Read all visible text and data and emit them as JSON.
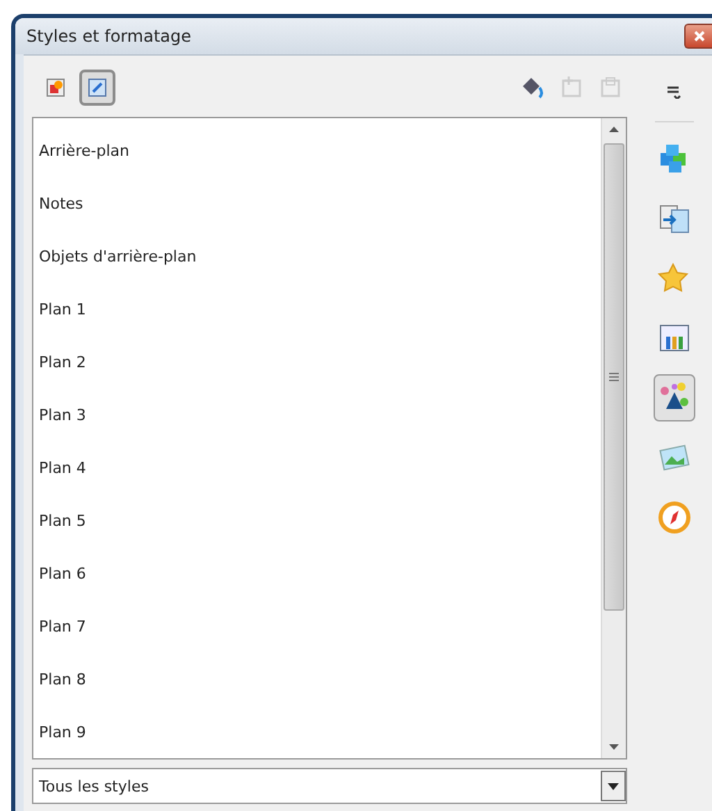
{
  "window": {
    "title": "Styles et formatage"
  },
  "style_families": [
    {
      "kind": "graphics",
      "selected": false
    },
    {
      "kind": "presentation",
      "selected": true
    }
  ],
  "styles": [
    "Arrière-plan",
    "Notes",
    "Objets d'arrière-plan",
    "Plan 1",
    "Plan 2",
    "Plan 3",
    "Plan 4",
    "Plan 5",
    "Plan 6",
    "Plan 7",
    "Plan 8",
    "Plan 9"
  ],
  "filter": {
    "value": "Tous les styles"
  },
  "deck": [
    {
      "kind": "properties",
      "selected": false
    },
    {
      "kind": "transition",
      "selected": false
    },
    {
      "kind": "animation",
      "selected": false
    },
    {
      "kind": "layouts",
      "selected": false
    },
    {
      "kind": "styles",
      "selected": true
    },
    {
      "kind": "gallery",
      "selected": false
    },
    {
      "kind": "navigator",
      "selected": false
    }
  ]
}
